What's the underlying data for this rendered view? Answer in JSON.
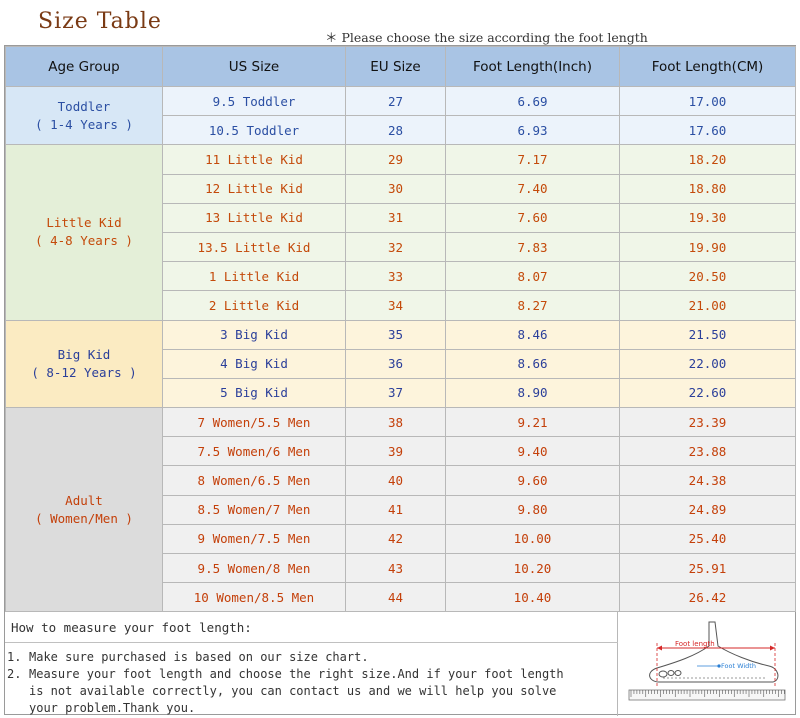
{
  "title": "Size Table",
  "subtitle": "＊ Please choose the size according the foot length",
  "headers": [
    "Age Group",
    "US Size",
    "EU Size",
    "Foot Length(Inch)",
    "Foot Length(CM)"
  ],
  "groups": [
    {
      "name": "Toddler",
      "range": "( 1-4 Years )",
      "rows": [
        {
          "us": "9.5 Toddler",
          "eu": "27",
          "inch": "6.69",
          "cm": "17.00"
        },
        {
          "us": "10.5 Toddler",
          "eu": "28",
          "inch": "6.93",
          "cm": "17.60"
        }
      ]
    },
    {
      "name": "Little Kid",
      "range": "( 4-8 Years )",
      "rows": [
        {
          "us": "11 Little Kid",
          "eu": "29",
          "inch": "7.17",
          "cm": "18.20"
        },
        {
          "us": "12 Little Kid",
          "eu": "30",
          "inch": "7.40",
          "cm": "18.80"
        },
        {
          "us": "13 Little Kid",
          "eu": "31",
          "inch": "7.60",
          "cm": "19.30"
        },
        {
          "us": "13.5 Little Kid",
          "eu": "32",
          "inch": "7.83",
          "cm": "19.90"
        },
        {
          "us": "1 Little Kid",
          "eu": "33",
          "inch": "8.07",
          "cm": "20.50"
        },
        {
          "us": "2 Little Kid",
          "eu": "34",
          "inch": "8.27",
          "cm": "21.00"
        }
      ]
    },
    {
      "name": "Big Kid",
      "range": "( 8-12 Years )",
      "rows": [
        {
          "us": "3 Big Kid",
          "eu": "35",
          "inch": "8.46",
          "cm": "21.50"
        },
        {
          "us": "4 Big Kid",
          "eu": "36",
          "inch": "8.66",
          "cm": "22.00"
        },
        {
          "us": "5 Big Kid",
          "eu": "37",
          "inch": "8.90",
          "cm": "22.60"
        }
      ]
    },
    {
      "name": "Adult",
      "range": "( Women/Men )",
      "rows": [
        {
          "us": "7 Women/5.5 Men",
          "eu": "38",
          "inch": "9.21",
          "cm": "23.39"
        },
        {
          "us": "7.5 Women/6 Men",
          "eu": "39",
          "inch": "9.40",
          "cm": "23.88"
        },
        {
          "us": "8 Women/6.5 Men",
          "eu": "40",
          "inch": "9.60",
          "cm": "24.38"
        },
        {
          "us": "8.5 Women/7 Men",
          "eu": "41",
          "inch": "9.80",
          "cm": "24.89"
        },
        {
          "us": "9 Women/7.5 Men",
          "eu": "42",
          "inch": "10.00",
          "cm": "25.40"
        },
        {
          "us": "9.5 Women/8 Men",
          "eu": "43",
          "inch": "10.20",
          "cm": "25.91"
        },
        {
          "us": "10 Women/8.5 Men",
          "eu": "44",
          "inch": "10.40",
          "cm": "26.42"
        }
      ]
    }
  ],
  "howto": {
    "title": "How to measure your foot length:",
    "items": [
      {
        "num": "1.",
        "text": "Make sure purchased is based on our size chart."
      },
      {
        "num": "2.",
        "text": "Measure your foot length and choose the right size.And if your foot length is not available correctly, you can contact us and we will help you solve your problem.Thank you."
      }
    ]
  },
  "diagram": {
    "length_label": "Foot length",
    "width_label": "Foot Width",
    "colors": {
      "length": "#d62828",
      "width": "#2a7fd4"
    }
  }
}
